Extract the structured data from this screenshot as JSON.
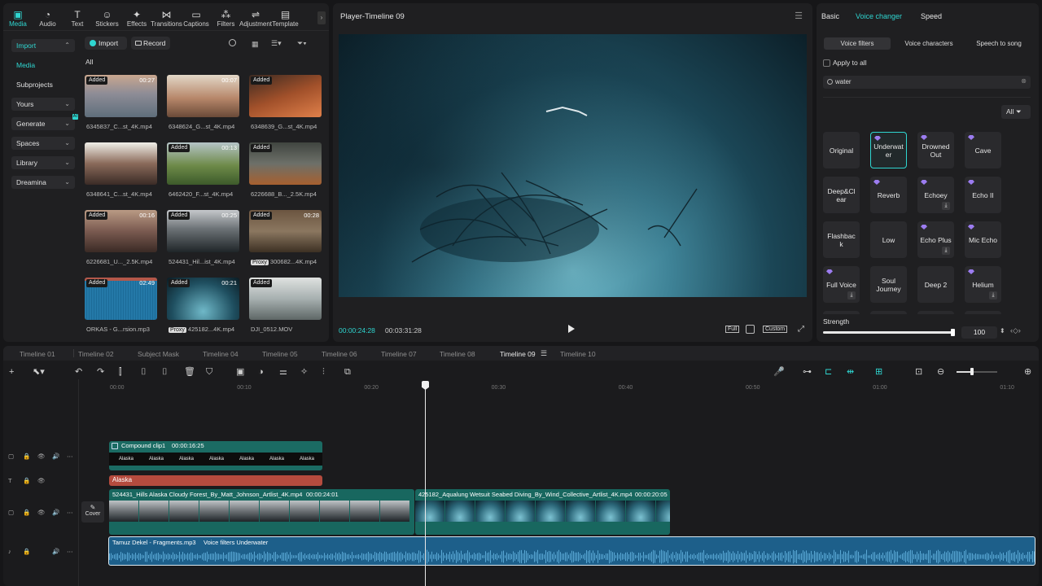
{
  "toolbar": {
    "tools": [
      {
        "label": "Media",
        "icon": "media-icon"
      },
      {
        "label": "Audio",
        "icon": "audio-icon"
      },
      {
        "label": "Text",
        "icon": "text-icon"
      },
      {
        "label": "Stickers",
        "icon": "stickers-icon"
      },
      {
        "label": "Effects",
        "icon": "effects-icon"
      },
      {
        "label": "Transitions",
        "icon": "transitions-icon"
      },
      {
        "label": "Captions",
        "icon": "captions-icon"
      },
      {
        "label": "Filters",
        "icon": "filters-icon"
      },
      {
        "label": "Adjustment",
        "icon": "adjustment-icon"
      },
      {
        "label": "Template",
        "icon": "template-icon"
      }
    ],
    "more_icon": "chevron-right-icon"
  },
  "sidebar": {
    "items": [
      {
        "label": "Import"
      },
      {
        "label": "Media"
      },
      {
        "label": "Subprojects"
      },
      {
        "label": "Yours"
      },
      {
        "label": "Generate"
      },
      {
        "label": "Spaces"
      },
      {
        "label": "Library"
      },
      {
        "label": "Dreamina"
      }
    ],
    "ai_badge": "AI"
  },
  "media": {
    "import_label": "Import",
    "record_label": "Record",
    "filter_label": "All",
    "items": [
      {
        "name": "6345837_C...st_4K.mp4",
        "badge": "Added",
        "duration": "00:27",
        "proxy": ""
      },
      {
        "name": "6348624_G...st_4K.mp4",
        "badge": "",
        "duration": "00:07",
        "proxy": ""
      },
      {
        "name": "6348639_G...st_4K.mp4",
        "badge": "Added",
        "duration": "",
        "proxy": ""
      },
      {
        "name": "6348641_C...st_4K.mp4",
        "badge": "",
        "duration": "",
        "proxy": ""
      },
      {
        "name": "6462420_F...st_4K.mp4",
        "badge": "Added",
        "duration": "00:13",
        "proxy": ""
      },
      {
        "name": "6226688_B..._2.5K.mp4",
        "badge": "Added",
        "duration": "",
        "proxy": ""
      },
      {
        "name": "6226681_U..._2.5K.mp4",
        "badge": "Added",
        "duration": "00:16",
        "proxy": ""
      },
      {
        "name": "524431_Hil...ist_4K.mp4",
        "badge": "Added",
        "duration": "00:25",
        "proxy": ""
      },
      {
        "name": "300682...4K.mp4",
        "badge": "Added",
        "duration": "00:28",
        "proxy": "Proxy"
      },
      {
        "name": "ORKAS - G...rsion.mp3",
        "badge": "Added",
        "duration": "02:49",
        "proxy": ""
      },
      {
        "name": "425182...4K.mp4",
        "badge": "Added",
        "duration": "00:21",
        "proxy": "Proxy"
      },
      {
        "name": "DJI_0512.MOV",
        "badge": "Added",
        "duration": "",
        "proxy": ""
      }
    ]
  },
  "player": {
    "title": "Player-Timeline 09",
    "current_time": "00:00:24:28",
    "total_time": "00:03:31:28",
    "full_label": "Full",
    "ratio_label": "Custom"
  },
  "right": {
    "tabs": [
      "Basic",
      "Voice changer",
      "Speed"
    ],
    "subtabs": [
      "Voice filters",
      "Voice characters",
      "Speech to song"
    ],
    "apply_all": "Apply to all",
    "search_value": "water",
    "filter_label": "All",
    "filters": [
      {
        "label": "Original",
        "gem": false,
        "dl": false
      },
      {
        "label": "Underwat er",
        "gem": true,
        "dl": false
      },
      {
        "label": "Drowned Out",
        "gem": true,
        "dl": false
      },
      {
        "label": "Cave",
        "gem": true,
        "dl": false
      },
      {
        "label": "Deep&Cl ear",
        "gem": false,
        "dl": false
      },
      {
        "label": "Reverb",
        "gem": true,
        "dl": false
      },
      {
        "label": "Echoey",
        "gem": true,
        "dl": true
      },
      {
        "label": "Echo II",
        "gem": true,
        "dl": false
      },
      {
        "label": "Flashbac k",
        "gem": false,
        "dl": false
      },
      {
        "label": "Low",
        "gem": false,
        "dl": false
      },
      {
        "label": "Echo Plus",
        "gem": true,
        "dl": true
      },
      {
        "label": "Mic Echo",
        "gem": true,
        "dl": false
      },
      {
        "label": "Full Voice",
        "gem": true,
        "dl": true
      },
      {
        "label": "Soul Journey",
        "gem": false,
        "dl": false
      },
      {
        "label": "Deep 2",
        "gem": false,
        "dl": false
      },
      {
        "label": "Helium",
        "gem": true,
        "dl": true
      }
    ],
    "strength_label": "Strength",
    "strength_value": "100",
    "strength_fraction": 1.0
  },
  "timeline": {
    "tabs": [
      "Timeline 01",
      "Timeline 02",
      "Subject Mask",
      "Timeline 04",
      "Timeline 05",
      "Timeline 06",
      "Timeline 07",
      "Timeline 08",
      "Timeline 09",
      "Timeline 10"
    ],
    "active_tab": "Timeline 09",
    "ticks": [
      "00:00",
      "00:10",
      "00:20",
      "00:30",
      "00:40",
      "00:50",
      "01:00",
      "01:10"
    ],
    "compound": {
      "name": "Compound clip1",
      "duration": "00:00:16:25",
      "sub": "Alaska"
    },
    "text_clip": "Alaska",
    "video1": {
      "name": "524431_Hills Alaska Cloudy Forest_By_Matt_Johnson_Artlist_4K.mp4",
      "duration": "00:00:24:01"
    },
    "video2": {
      "name": "425182_Aqualung Wetsuit Seabed Diving_By_Wind_Collective_Artlist_4K.mp4",
      "duration": "00:00:20:05"
    },
    "cover_label": "Cover",
    "audio": {
      "name": "Tamuz Dekel - Fragments.mp3",
      "effect": "Voice filters Underwater"
    }
  },
  "colors": {
    "accent": "#2fd6d1",
    "compound": "#1b6b63",
    "text_clip": "#b54b3e",
    "video": "#18675f",
    "audio": "#1d5f8a"
  }
}
